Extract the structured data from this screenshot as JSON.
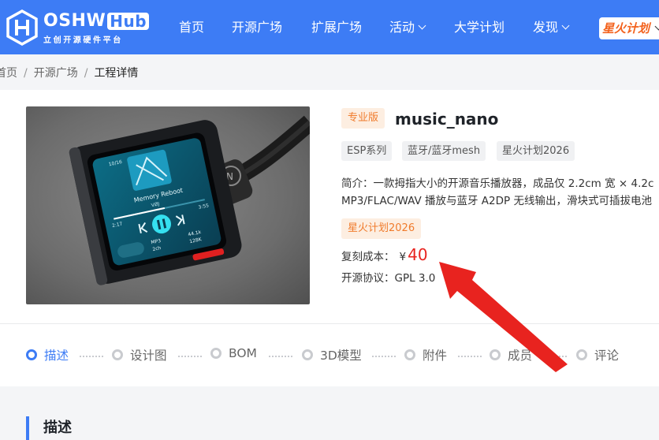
{
  "header": {
    "logo_main": "OSHW",
    "logo_hub": "Hub",
    "logo_sub": "立创开源硬件平台",
    "nav": [
      "首页",
      "开源广场",
      "扩展广场",
      "活动",
      "大学计划",
      "发现"
    ],
    "spark_badge": "星火计划"
  },
  "breadcrumb": {
    "items": [
      "首页",
      "开源广场"
    ],
    "current": "工程详情",
    "separator": "/"
  },
  "project": {
    "edition": "专业版",
    "title": "music_nano",
    "tags": [
      "ESP系列",
      "蓝牙/蓝牙mesh",
      "星火计划2026"
    ],
    "intro_line1": "简介：一款拇指大小的开源音乐播放器，成品仅 2.2cm 宽 × 4.2c",
    "intro_line2": "MP3/FLAC/WAV 播放与蓝牙 A2DP 无线输出，滑块式可插拔电池",
    "spark_tag": "星火计划2026",
    "cost_label": "复刻成本：",
    "cost_currency": "¥",
    "cost_value": "40",
    "license_label": "开源协议：",
    "license_value": "GPL 3.0"
  },
  "device_screen": {
    "song": "Memory Reboot",
    "artist": "VØJ",
    "time_elapsed": "2:17",
    "time_total": "3:55",
    "format": "MP3",
    "channels": "2ch",
    "sample_rate": "44.1k",
    "bitrate": "128K",
    "volume": "10/16"
  },
  "tabs": [
    "描述",
    "设计图",
    "BOM",
    "3D模型",
    "附件",
    "成员",
    "评论"
  ],
  "active_tab": 0,
  "section_title": "描述",
  "colors": {
    "brand": "#3d7cf5",
    "accent_orange": "#f07b2c",
    "price_red": "#e8231f",
    "arrow_red": "#e8231f"
  }
}
